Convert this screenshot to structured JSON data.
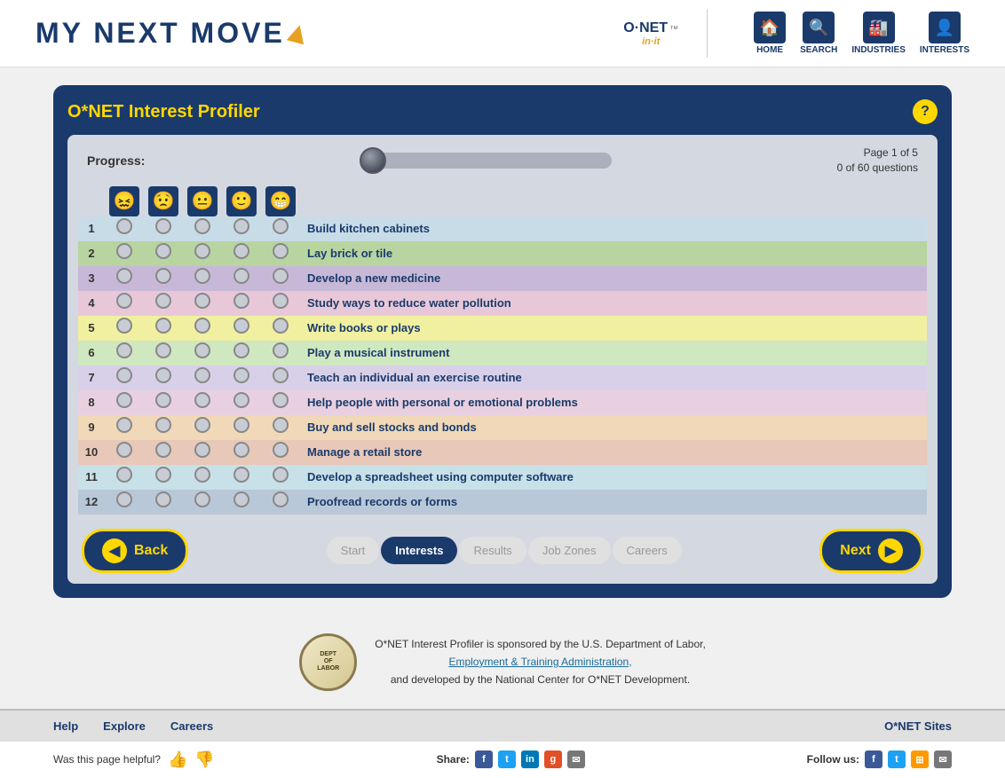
{
  "header": {
    "logo_text": "MY NEXT MOVE",
    "onet_logo": "O·NET",
    "onet_sub": "in·it",
    "nav_items": [
      {
        "label": "HOME",
        "icon": "🏠"
      },
      {
        "label": "SEARCH",
        "icon": "🔍"
      },
      {
        "label": "INDUSTRIES",
        "icon": "🏭"
      },
      {
        "label": "INTERESTS",
        "icon": "👤"
      }
    ]
  },
  "profiler": {
    "title": "O*NET Interest Profiler",
    "help_label": "?",
    "progress_label": "Progress:",
    "page_info": "Page 1 of 5",
    "questions_info": "0 of 60 questions",
    "emojis": [
      "😖",
      "😟",
      "😐",
      "🙂",
      "😁"
    ],
    "questions": [
      {
        "num": 1,
        "text": "Build kitchen cabinets",
        "color_class": "row-1"
      },
      {
        "num": 2,
        "text": "Lay brick or tile",
        "color_class": "row-2"
      },
      {
        "num": 3,
        "text": "Develop a new medicine",
        "color_class": "row-3"
      },
      {
        "num": 4,
        "text": "Study ways to reduce water pollution",
        "color_class": "row-4"
      },
      {
        "num": 5,
        "text": "Write books or plays",
        "color_class": "row-5"
      },
      {
        "num": 6,
        "text": "Play a musical instrument",
        "color_class": "row-6"
      },
      {
        "num": 7,
        "text": "Teach an individual an exercise routine",
        "color_class": "row-7"
      },
      {
        "num": 8,
        "text": "Help people with personal or emotional problems",
        "color_class": "row-8"
      },
      {
        "num": 9,
        "text": "Buy and sell stocks and bonds",
        "color_class": "row-9"
      },
      {
        "num": 10,
        "text": "Manage a retail store",
        "color_class": "row-10"
      },
      {
        "num": 11,
        "text": "Develop a spreadsheet using computer software",
        "color_class": "row-11"
      },
      {
        "num": 12,
        "text": "Proofread records or forms",
        "color_class": "row-12"
      }
    ]
  },
  "navigation": {
    "back_label": "Back",
    "next_label": "Next",
    "steps": [
      {
        "label": "Start",
        "active": false
      },
      {
        "label": "Interests",
        "active": true
      },
      {
        "label": "Results",
        "active": false
      },
      {
        "label": "Job Zones",
        "active": false
      },
      {
        "label": "Careers",
        "active": false
      }
    ]
  },
  "sponsor": {
    "text_line1": "O*NET Interest Profiler is sponsored by the U.S. Department of Labor,",
    "text_link": "Employment & Training Administration,",
    "text_line3": "and developed by the National Center for O*NET Development."
  },
  "bottom_nav": {
    "links": [
      "Help",
      "Explore",
      "Careers"
    ],
    "right": "O*NET Sites"
  },
  "very_bottom": {
    "helpful_label": "Was this page helpful?",
    "share_label": "Share:",
    "follow_label": "Follow us:"
  }
}
